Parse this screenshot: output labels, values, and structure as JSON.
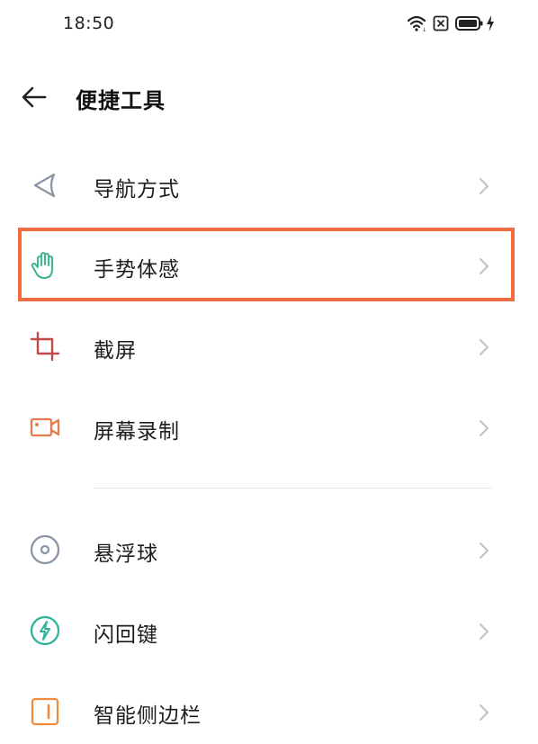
{
  "status": {
    "time": "18:50"
  },
  "header": {
    "title": "便捷工具"
  },
  "items": [
    {
      "label": "导航方式",
      "icon": "navigation-icon",
      "color": "#8a95a6"
    },
    {
      "label": "手势体感",
      "icon": "hand-gesture-icon",
      "color": "#3fb892"
    },
    {
      "label": "截屏",
      "icon": "crop-screenshot-icon",
      "color": "#c24a4a"
    },
    {
      "label": "屏幕录制",
      "icon": "screen-record-icon",
      "color": "#e57a4a"
    },
    {
      "label": "悬浮球",
      "icon": "floating-ball-icon",
      "color": "#8a95a6"
    },
    {
      "label": "闪回键",
      "icon": "flashback-icon",
      "color": "#2fb39a"
    },
    {
      "label": "智能侧边栏",
      "icon": "smart-sidebar-icon",
      "color": "#f08a3c"
    }
  ],
  "highlight_color": "#f26c3f"
}
